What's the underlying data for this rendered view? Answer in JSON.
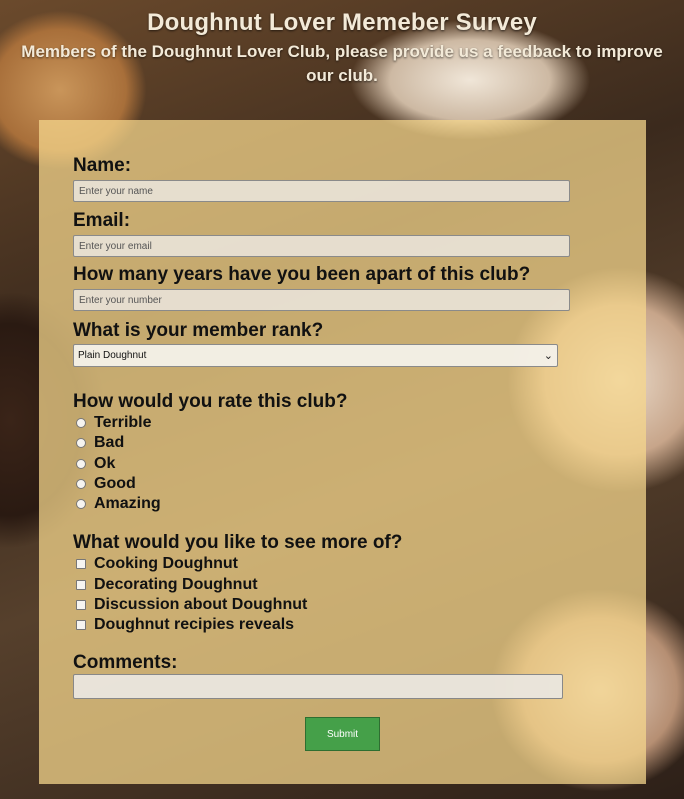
{
  "header": {
    "title": "Doughnut Lover Memeber Survey",
    "subtitle": "Members of the Doughnut Lover Club, please provide us a feedback to improve our club."
  },
  "form": {
    "name_label": "Name:",
    "name_placeholder": "Enter your name",
    "email_label": "Email:",
    "email_placeholder": "Enter your email",
    "years_label": "How many years have you been apart of this club?",
    "years_placeholder": "Enter your number",
    "rank_label": "What is your member rank?",
    "rank_selected": "Plain Doughnut",
    "rate_label": "How would you rate this club?",
    "rate_options": [
      "Terrible",
      "Bad",
      "Ok",
      "Good",
      "Amazing"
    ],
    "more_label": "What would you like to see more of?",
    "more_options": [
      "Cooking Doughnut",
      "Decorating Doughnut",
      "Discussion about Doughnut",
      "Doughnut recipies reveals"
    ],
    "comments_label": "Comments:",
    "submit_label": "Submit"
  },
  "colors": {
    "panel": "#f6d68c",
    "submit": "#45a049"
  }
}
